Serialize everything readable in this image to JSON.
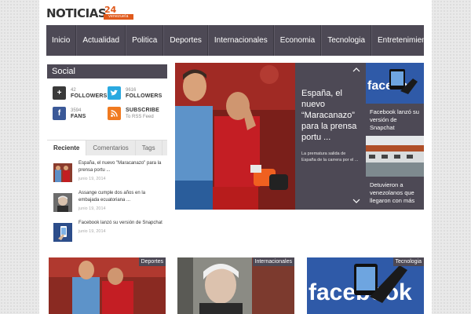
{
  "header": {
    "logo_main": "NOTICIAS",
    "logo_number": "24",
    "logo_sub": "venezuela"
  },
  "nav": {
    "items": [
      "Inicio",
      "Actualidad",
      "Politica",
      "Deportes",
      "Internacionales",
      "Economia",
      "Tecnologia",
      "Entretenimiento"
    ]
  },
  "social": {
    "title": "Social",
    "gplus": {
      "count": "42",
      "label": "FOLLOWERS",
      "icon": "google-plus-icon"
    },
    "twitter": {
      "count": "9616",
      "label": "FOLLOWERS",
      "icon": "twitter-icon"
    },
    "facebook": {
      "count": "3594",
      "label": "FANS",
      "icon": "facebook-icon"
    },
    "rss": {
      "count": "SUBSCRIBE",
      "label": "To RSS Feed",
      "icon": "rss-icon"
    }
  },
  "tabs": [
    "Reciente",
    "Comentarios",
    "Tags"
  ],
  "recent": [
    {
      "title": "España, el nuevo \"Maracanazo\" para la prensa portu ...",
      "date": "junio 19, 2014"
    },
    {
      "title": "Assange cumple dos años en la embajada ecuatoriana ...",
      "date": "junio 19, 2014"
    },
    {
      "title": "Facebook lanzó su versión de Snapchat",
      "date": "junio 19, 2014"
    }
  ],
  "featured": {
    "title": "España, el nuevo “Maracanazo” para la prensa portu ...",
    "excerpt": "La prematura salida de España de la carrera por el ..."
  },
  "side_stories": [
    {
      "title": "Facebook lanzó su versión de Snapchat"
    },
    {
      "title": "Detuvieron a venezolanos que llegaron con más"
    }
  ],
  "cards": [
    {
      "badge": "Deportes"
    },
    {
      "badge": "Internacionales"
    },
    {
      "badge": "Tecnologia"
    }
  ],
  "colors": {
    "dark": "#4d4955",
    "accent": "#e05a1c"
  }
}
